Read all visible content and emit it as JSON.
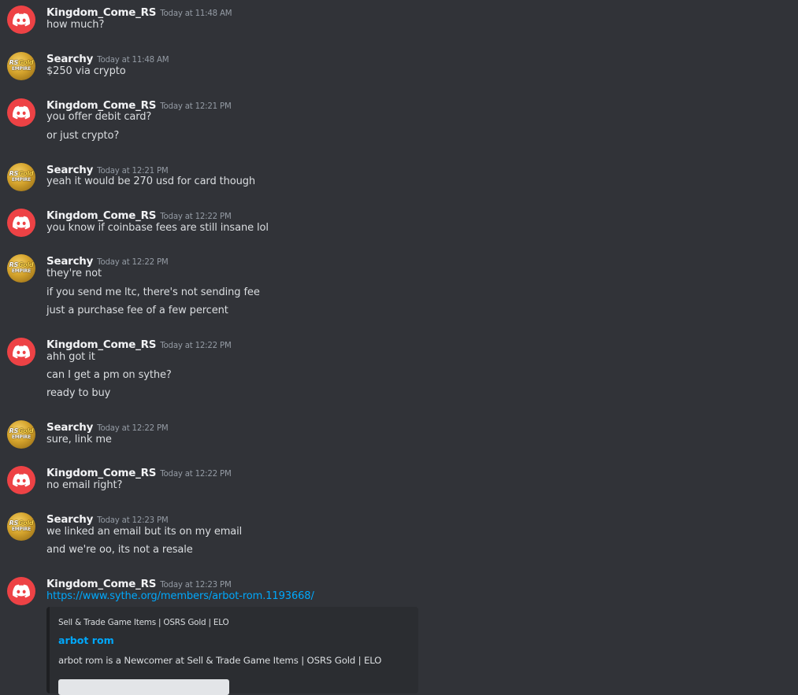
{
  "messages": [
    {
      "author": "Kingdom_Come_RS",
      "avatar": "discord-logo-icon",
      "timestamp": "Today at 11:48 AM",
      "lines": [
        "how much?"
      ]
    },
    {
      "author": "Searchy",
      "avatar": "rsgold-empire-logo",
      "timestamp": "Today at 11:48 AM",
      "lines": [
        "$250 via crypto"
      ]
    },
    {
      "author": "Kingdom_Come_RS",
      "avatar": "discord-logo-icon",
      "timestamp": "Today at 12:21 PM",
      "lines": [
        "you offer debit card?",
        "or just crypto?"
      ]
    },
    {
      "author": "Searchy",
      "avatar": "rsgold-empire-logo",
      "timestamp": "Today at 12:21 PM",
      "lines": [
        "yeah it would be 270 usd for card though"
      ]
    },
    {
      "author": "Kingdom_Come_RS",
      "avatar": "discord-logo-icon",
      "timestamp": "Today at 12:22 PM",
      "lines": [
        "you know if coinbase fees are still insane lol"
      ]
    },
    {
      "author": "Searchy",
      "avatar": "rsgold-empire-logo",
      "timestamp": "Today at 12:22 PM",
      "lines": [
        "they're not",
        "if you send me ltc, there's not sending fee",
        "just a purchase fee of a few percent"
      ]
    },
    {
      "author": "Kingdom_Come_RS",
      "avatar": "discord-logo-icon",
      "timestamp": "Today at 12:22 PM",
      "lines": [
        "ahh got it",
        "can I get a pm on sythe?",
        "ready to buy"
      ]
    },
    {
      "author": "Searchy",
      "avatar": "rsgold-empire-logo",
      "timestamp": "Today at 12:22 PM",
      "lines": [
        "sure, link me"
      ]
    },
    {
      "author": "Kingdom_Come_RS",
      "avatar": "discord-logo-icon",
      "timestamp": "Today at 12:22 PM",
      "lines": [
        "no email right?"
      ]
    },
    {
      "author": "Searchy",
      "avatar": "rsgold-empire-logo",
      "timestamp": "Today at 12:23 PM",
      "lines": [
        "we linked an email but its on my email",
        "and we're oo, its not a resale"
      ]
    },
    {
      "author": "Kingdom_Come_RS",
      "avatar": "discord-logo-icon",
      "timestamp": "Today at 12:23 PM",
      "lines": [
        "https://www.sythe.org/members/arbot-rom.1193668/"
      ],
      "embed": {
        "provider": "Sell & Trade Game Items | OSRS Gold | ELO",
        "title": "arbot rom",
        "description": "arbot rom is a Newcomer at Sell & Trade Game Items | OSRS Gold | ELO"
      }
    }
  ],
  "avatar_logo": {
    "line1_rs": "RS",
    "line1_gold": "Gold",
    "line2": "EMPIRE"
  },
  "colors": {
    "background": "#313338",
    "text": "#dbdee1",
    "username": "#f2f3f5",
    "timestamp": "#949ba4",
    "link": "#00a8fc",
    "discord_red": "#ed4245",
    "embed_background": "#2b2d31"
  }
}
